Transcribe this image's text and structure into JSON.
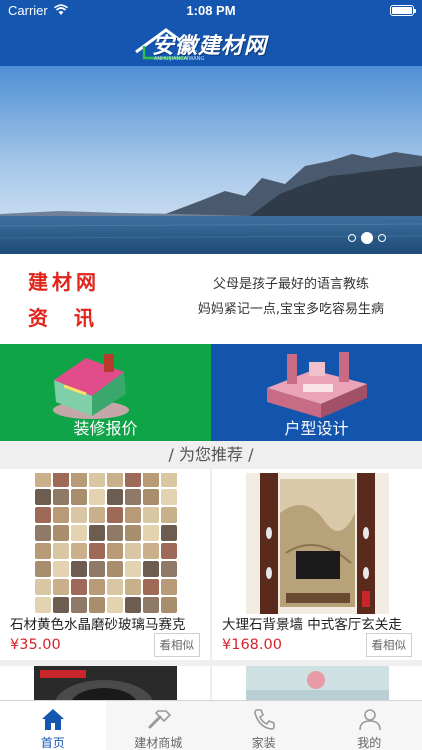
{
  "status_bar": {
    "carrier": "Carrier",
    "time": "1:08 PM",
    "battery_level": 1.0
  },
  "header": {
    "logo_text": "安徽建材网"
  },
  "banner": {
    "page_count": 3,
    "active_index": 1
  },
  "news": {
    "logo_line1": "建材网",
    "logo_line2": "资讯",
    "items": [
      "父母是孩子最好的语言教练",
      "妈妈紧记一点,宝宝多吃容易生病"
    ]
  },
  "tiles": [
    {
      "label": "装修报价",
      "color": "#10a448"
    },
    {
      "label": "户型设计",
      "color": "#1354ad"
    }
  ],
  "section": {
    "title": "/ 为您推荐 /"
  },
  "products": [
    {
      "name": "石材黄色水晶磨砂玻璃马赛克",
      "price": "¥35.00",
      "action": "看相似"
    },
    {
      "name": "大理石背景墙 中式客厅玄关走",
      "price": "¥168.00",
      "action": "看相似"
    }
  ],
  "tabbar": {
    "tabs": [
      {
        "label": "首页",
        "icon": "home-icon",
        "active": true
      },
      {
        "label": "建材商城",
        "icon": "hammer-icon",
        "active": false
      },
      {
        "label": "家装",
        "icon": "phone-icon",
        "active": false
      },
      {
        "label": "我的",
        "icon": "user-icon",
        "active": false
      }
    ]
  },
  "colors": {
    "brand_blue": "#1456b0",
    "price_red": "#d8232a",
    "news_red": "#e0241b"
  }
}
